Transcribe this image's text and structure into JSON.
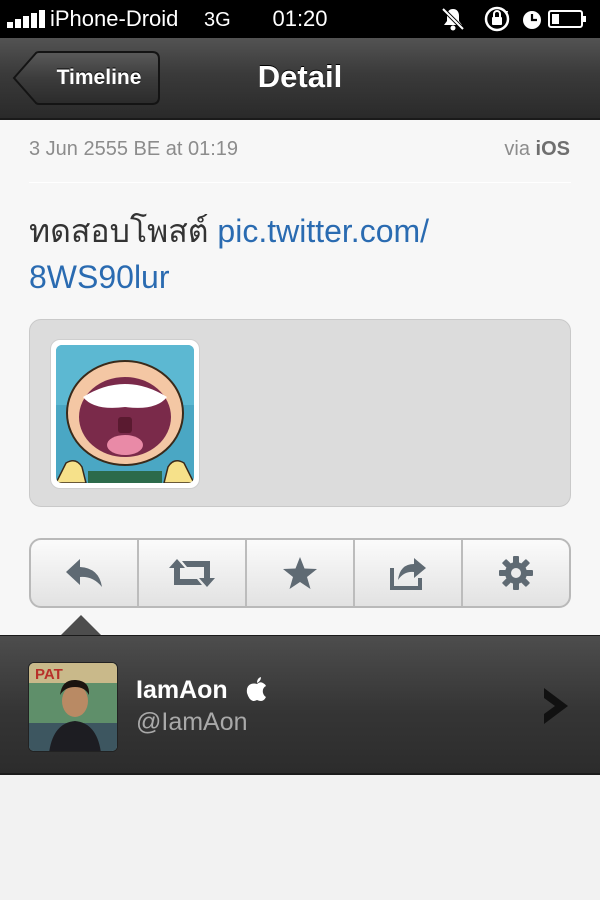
{
  "status_bar": {
    "carrier": "iPhone-Droid",
    "network": "3G",
    "time": "01:20",
    "signal_bars": 5,
    "icons": [
      "bell-muted-icon",
      "rotation-lock-icon",
      "alarm-clock-icon",
      "battery-icon"
    ]
  },
  "nav": {
    "back_label": "Timeline",
    "title": "Detail"
  },
  "tweet": {
    "date": "3 Jun 2555 BE at 01:19",
    "via_prefix": "via",
    "via_source": "iOS",
    "text": "ทดสอบโพสต์",
    "link_line1": "pic.twitter.com/",
    "link_line2": "8WS90lur"
  },
  "media": {
    "thumbnail_icon": "cartoon-face-icon"
  },
  "actions": [
    {
      "name": "reply",
      "icon": "reply-icon"
    },
    {
      "name": "retweet",
      "icon": "retweet-icon"
    },
    {
      "name": "favorite",
      "icon": "star-icon"
    },
    {
      "name": "share",
      "icon": "share-icon"
    },
    {
      "name": "settings",
      "icon": "gear-icon"
    }
  ],
  "profile": {
    "name": "IamAon",
    "handle": "@IamAon",
    "avatar_sign_text": "PAT"
  },
  "colors": {
    "link": "#2a6bb1",
    "nav_bar": "#3a3a3a",
    "profile_bar": "#353535",
    "content_bg": "#f7f7f7"
  }
}
